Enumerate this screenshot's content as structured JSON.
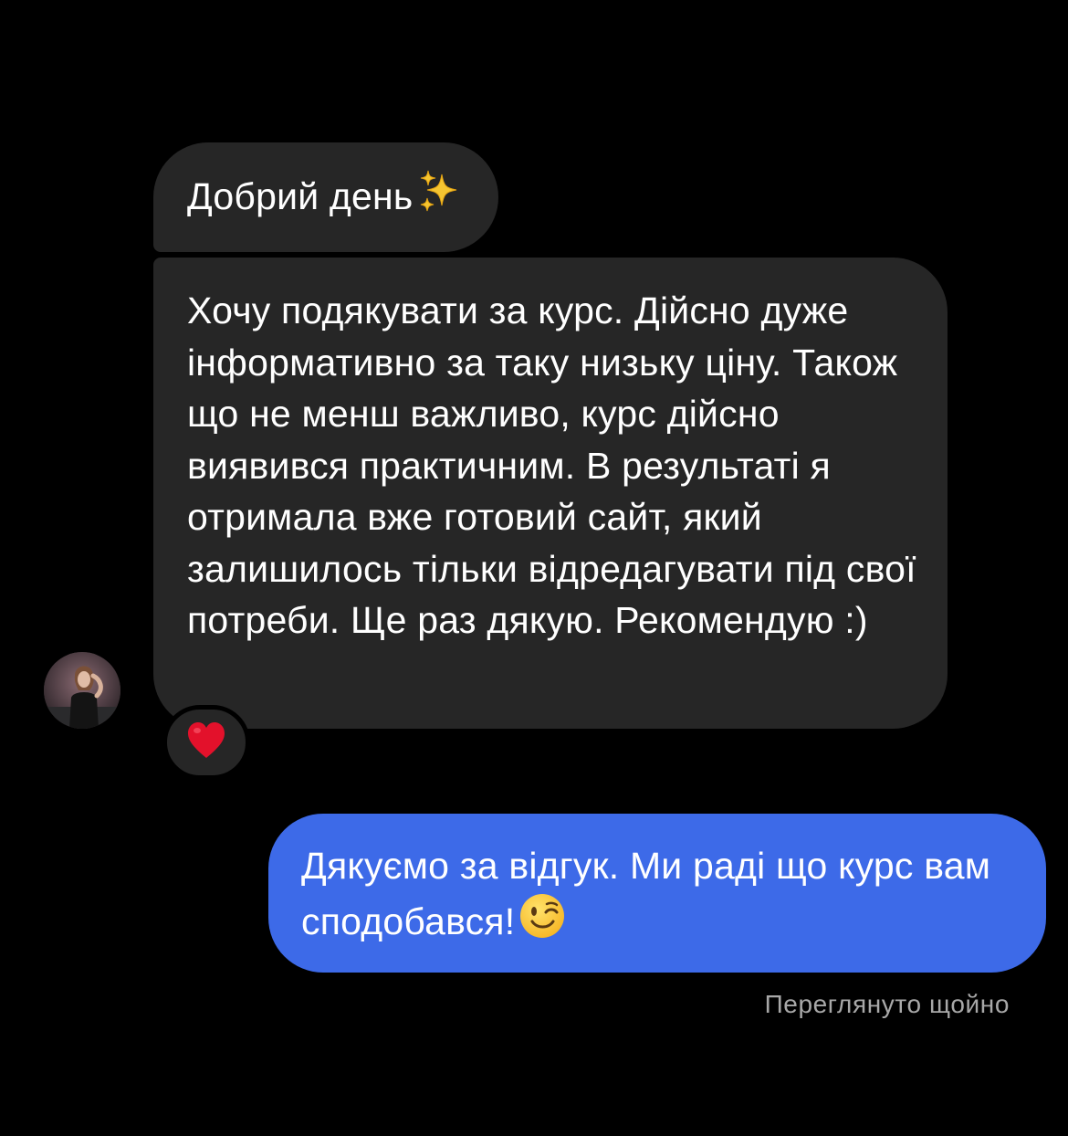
{
  "conversation": {
    "messages": [
      {
        "sender": "other",
        "text": "Добрий день",
        "trailing_icon": "sparkles-icon"
      },
      {
        "sender": "other",
        "text": "Хочу подякувати за курс. Дійсно дуже інформативно за таку низьку ціну. Також що не менш важливо, курс дійсно виявився практичним. В результаті я отримала вже готовий сайт, який залишилось тільки відредагувати під свої потреби. Ще раз дякую. Рекомендую :)",
        "reaction": "heart-icon"
      },
      {
        "sender": "me",
        "text": "Дякуємо за відгук. Ми раді що курс вам сподобався!",
        "trailing_icon": "winking-face-icon"
      }
    ],
    "seen_status": "Переглянуто щойно"
  },
  "colors": {
    "background": "#000000",
    "incoming_bubble": "#262626",
    "outgoing_bubble": "#3d6ae8",
    "text": "#ffffff",
    "status_text": "#a8a8a8"
  }
}
